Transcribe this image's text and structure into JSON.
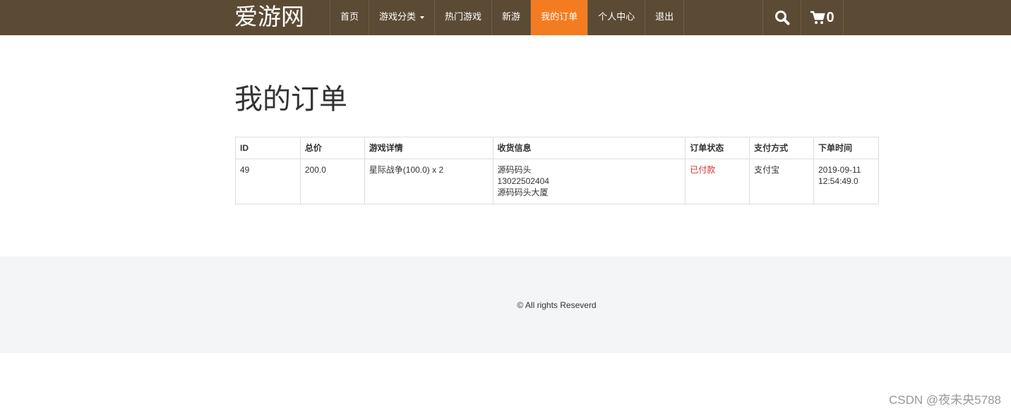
{
  "brand": "爱游网",
  "nav": {
    "items": [
      "首页",
      "游戏分类",
      "热门游戏",
      "新游",
      "我的订单",
      "个人中心",
      "退出"
    ],
    "active": "我的订单",
    "cart_count": "0"
  },
  "colors": {
    "nav_bg": "#5c4b34",
    "accent": "#f47c20",
    "status_paid": "#d9312b"
  },
  "page_title": "我的订单",
  "table": {
    "headers": [
      "ID",
      "总价",
      "游戏详情",
      "收货信息",
      "订单状态",
      "支付方式",
      "下单时间"
    ],
    "rows": [
      {
        "id": "49",
        "total": "200.0",
        "games": "星际战争(100.0) x 2",
        "ship_name": "源码码头",
        "ship_phone": "13022502404",
        "ship_address": "源码码头大厦",
        "status": "已付款",
        "payment": "支付宝",
        "date": "2019-09-11",
        "time": "12:54:49.0"
      }
    ]
  },
  "footer": "© All rights Reseverd",
  "watermark": "CSDN @夜未央5788"
}
